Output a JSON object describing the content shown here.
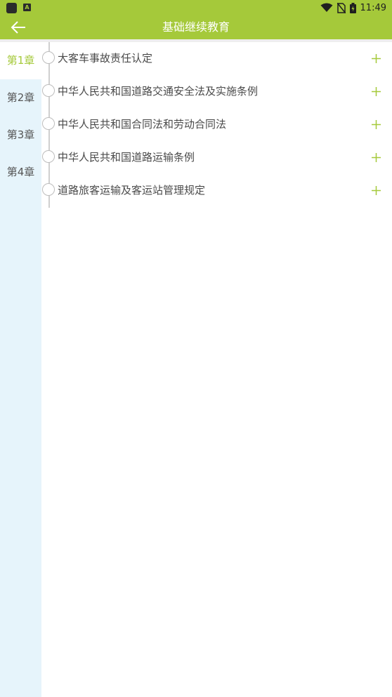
{
  "status_bar": {
    "time": "11:49",
    "icons": [
      "app-icon",
      "a-notification-icon",
      "wifi-icon",
      "no-sim-icon",
      "battery-icon"
    ],
    "notification_letter": "A"
  },
  "app_bar": {
    "title": "基础继续教育",
    "back_icon": "arrow-left-icon"
  },
  "colors": {
    "accent": "#a5c93a",
    "sidebar_bg": "#e6f4fb",
    "text": "#4a4a4a"
  },
  "chapters": [
    {
      "label": "第1章",
      "active": true
    },
    {
      "label": "第2章",
      "active": false
    },
    {
      "label": "第3章",
      "active": false
    },
    {
      "label": "第4章",
      "active": false
    }
  ],
  "sections": [
    {
      "title": "大客车事故责任认定"
    },
    {
      "title": "中华人民共和国道路交通安全法及实施条例"
    },
    {
      "title": "中华人民共和国合同法和劳动合同法"
    },
    {
      "title": "中华人民共和国道路运输条例"
    },
    {
      "title": "道路旅客运输及客运站管理规定"
    }
  ],
  "expand_icon": "plus-icon"
}
